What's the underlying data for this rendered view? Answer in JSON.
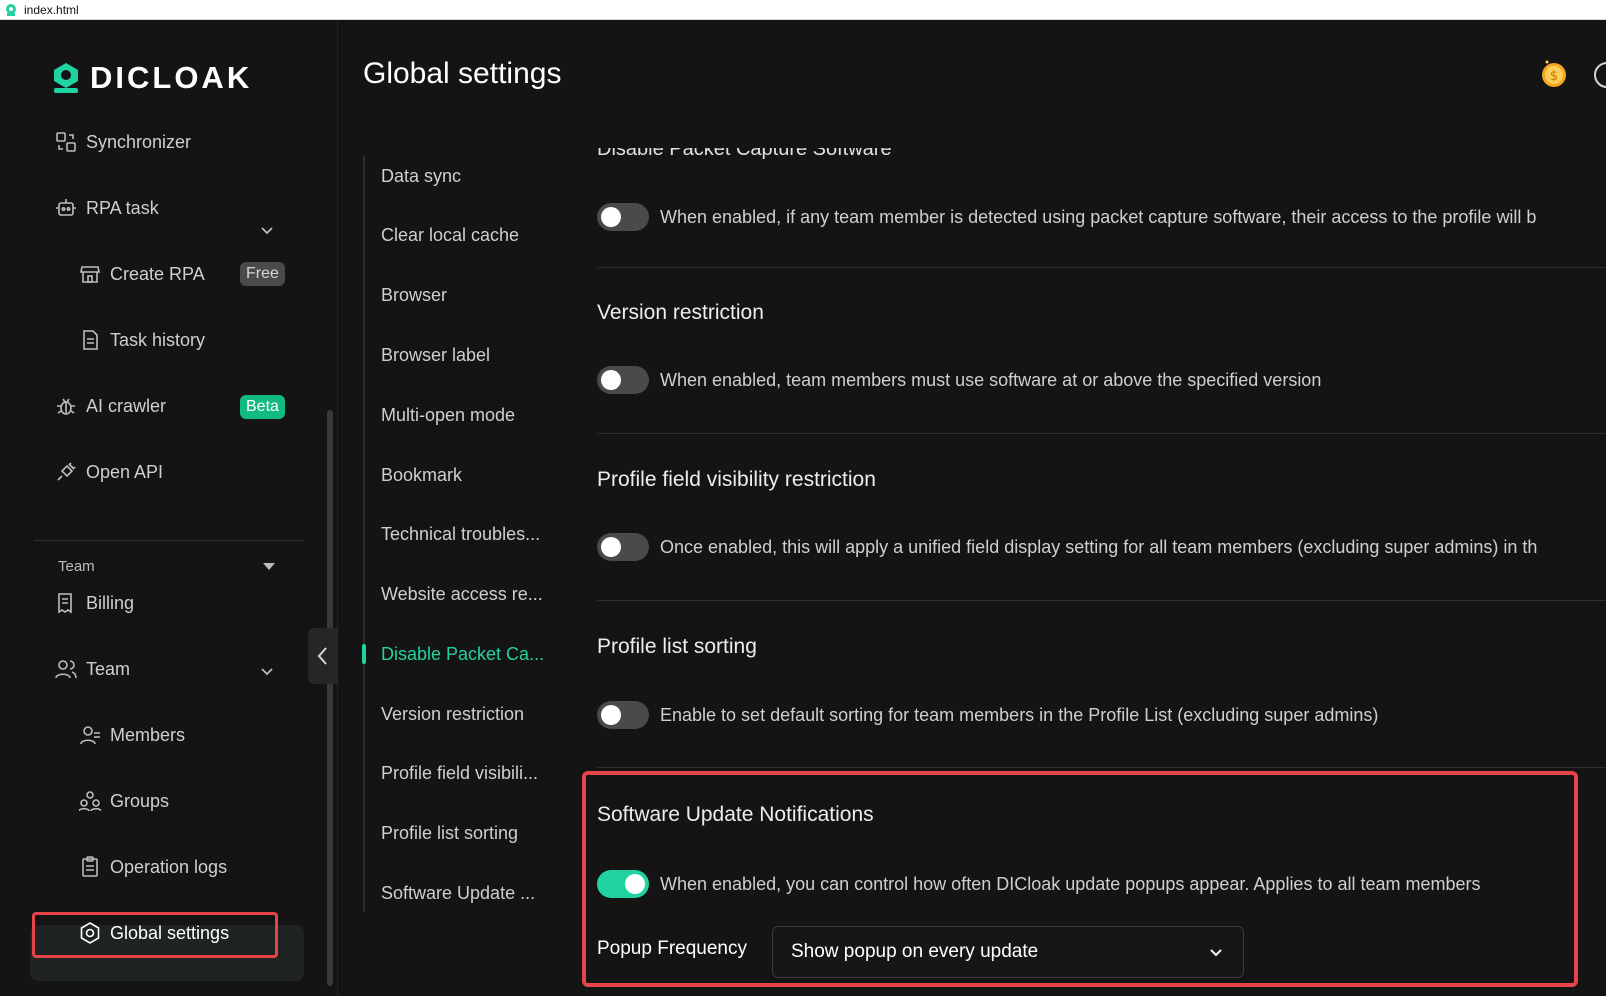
{
  "titlebar": {
    "filename": "index.html"
  },
  "logo": {
    "text": "DICLOAK"
  },
  "sidebar": {
    "items": [
      {
        "label": "Synchronizer",
        "icon": "sync-icon"
      },
      {
        "label": "RPA task",
        "icon": "robot-icon"
      },
      {
        "label": "Create RPA",
        "icon": "store-icon",
        "badge": "Free"
      },
      {
        "label": "Task history",
        "icon": "document-icon"
      },
      {
        "label": "AI crawler",
        "icon": "bug-icon",
        "badge": "Beta"
      },
      {
        "label": "Open API",
        "icon": "plug-icon"
      }
    ],
    "section_label": "Team",
    "team_items": [
      {
        "label": "Billing",
        "icon": "billing-icon"
      },
      {
        "label": "Team",
        "icon": "team-icon"
      },
      {
        "label": "Members",
        "icon": "members-icon"
      },
      {
        "label": "Groups",
        "icon": "groups-icon"
      },
      {
        "label": "Operation logs",
        "icon": "clipboard-icon"
      },
      {
        "label": "Global settings",
        "icon": "settings-icon"
      }
    ]
  },
  "page": {
    "title": "Global settings"
  },
  "anchors": [
    "Data sync",
    "Clear local cache",
    "Browser",
    "Browser label",
    "Multi-open mode",
    "Bookmark",
    "Technical troubles...",
    "Website access re...",
    "Disable Packet Ca...",
    "Version restriction",
    "Profile field visibili...",
    "Profile list sorting",
    "Software Update ..."
  ],
  "settings": {
    "packet_capture": {
      "title": "Disable Packet Capture Software",
      "desc": "When enabled, if any team member is detected using packet capture software, their access to the profile will b",
      "enabled": false
    },
    "version_restriction": {
      "title": "Version restriction",
      "desc": "When enabled, team members must use software at or above the specified version",
      "enabled": false
    },
    "field_visibility": {
      "title": "Profile field visibility restriction",
      "desc": "Once enabled, this will apply a unified field display setting for all team members (excluding super admins) in th",
      "enabled": false
    },
    "list_sorting": {
      "title": "Profile list sorting",
      "desc": "Enable to set default sorting for team members in the Profile List (excluding super admins)",
      "enabled": false
    },
    "update_notifications": {
      "title": "Software Update Notifications",
      "desc": "When enabled, you can control how often DICloak update popups appear. Applies to all team members",
      "enabled": true,
      "frequency_label": "Popup Frequency",
      "frequency_value": "Show popup on every update"
    }
  },
  "colors": {
    "accent": "#20d3a0",
    "highlight": "#e5454a",
    "background": "#141414"
  }
}
